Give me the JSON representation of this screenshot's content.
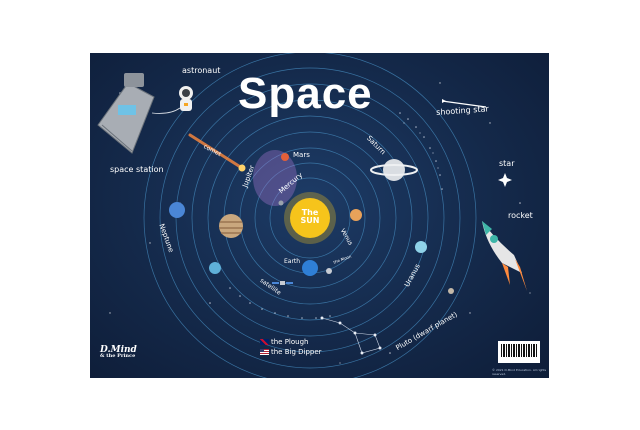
{
  "title": "Space",
  "labels": {
    "astronaut": "astronaut",
    "space_station": "space station",
    "comet": "comet",
    "mars": "Mars",
    "saturn": "Saturn",
    "jupiter": "Jupiter",
    "mercury": "Mercury",
    "sun": "The SUN",
    "venus": "Venus",
    "earth": "Earth",
    "moon": "the Moon",
    "neptune": "Neptune",
    "uranus": "Uranus",
    "satellite": "satellite",
    "pluto": "Pluto (dwarf planet)",
    "shooting_star": "shooting star",
    "star": "star",
    "rocket": "rocket",
    "plough": "the Plough",
    "big_dipper": "the Big Dipper"
  },
  "brand": {
    "line1": "D.Mind",
    "line2": "& the Prince"
  },
  "copyright": "© 2021 D.Mind Education. All rights reserved.",
  "colors": {
    "background": "#14294a",
    "orbit": "#3f7fb0",
    "sun": "#f6c41b",
    "mars": "#e2603a",
    "saturn": "#d9dde2",
    "jupiter": "#c9a77e",
    "venus": "#e8a25a",
    "neptune": "#4a86d6",
    "uranus": "#8fd2e8",
    "rocket": "#e6e6e6",
    "comet": "#ff8a3d"
  }
}
